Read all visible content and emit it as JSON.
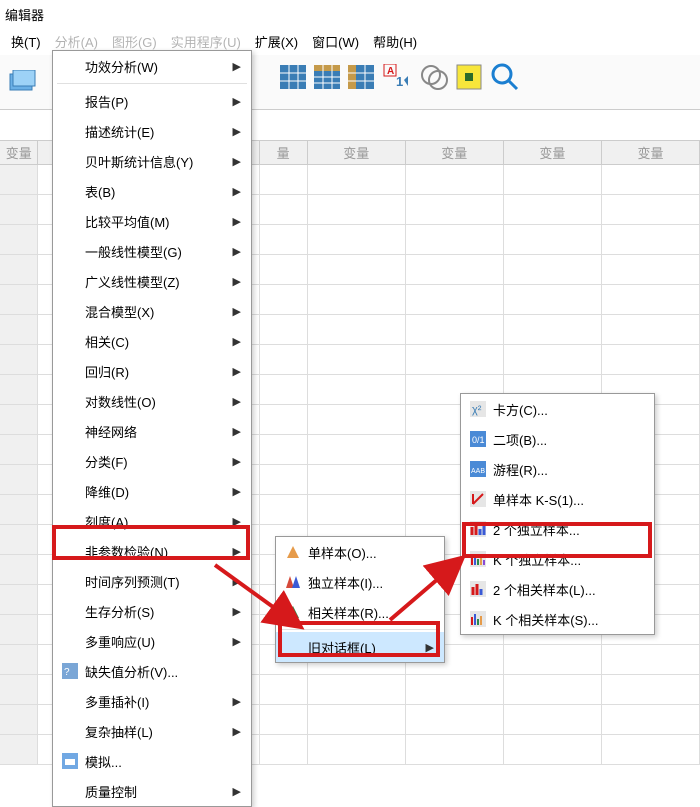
{
  "window": {
    "title": "编辑器"
  },
  "menubar": {
    "transform": "换(T)",
    "analyze_partial": "分析(A)",
    "graphs_partial": "图形(G)",
    "utilities_partial": "实用程序(U)",
    "extend": "扩展(X)",
    "window": "窗口(W)",
    "help": "帮助(H)"
  },
  "gridHeader": {
    "col1": "变量",
    "col2": "量",
    "col3": "变量",
    "col4": "变量",
    "col5": "变量",
    "col6": "变量"
  },
  "menu1": {
    "power": "功效分析(W)",
    "reports": "报告(P)",
    "desc": "描述统计(E)",
    "bayes": "贝叶斯统计信息(Y)",
    "tables": "表(B)",
    "compare": "比较平均值(M)",
    "glm": "一般线性模型(G)",
    "gnlm": "广义线性模型(Z)",
    "mixed": "混合模型(X)",
    "corr": "相关(C)",
    "reg": "回归(R)",
    "loglin": "对数线性(O)",
    "nn": "神经网络",
    "classify": "分类(F)",
    "dim": "降维(D)",
    "scale": "刻度(A)",
    "nonpar": "非参数检验(N)",
    "ts": "时间序列预测(T)",
    "surv": "生存分析(S)",
    "multi": "多重响应(U)",
    "missing": "缺失值分析(V)...",
    "impute": "多重插补(I)",
    "complex": "复杂抽样(L)",
    "sim": "模拟...",
    "qc": "质量控制"
  },
  "menu2": {
    "one": "单样本(O)...",
    "indep": "独立样本(I)...",
    "rel": "相关样本(R)...",
    "legacy": "旧对话框(L)"
  },
  "menu3": {
    "chi": "卡方(C)...",
    "binom": "二项(B)...",
    "runs": "游程(R)...",
    "ks": "单样本 K-S(1)...",
    "two_ind": "2 个独立样本...",
    "k_ind": "K 个独立样本...",
    "two_rel": "2 个相关样本(L)...",
    "k_rel": "K 个相关样本(S)..."
  }
}
